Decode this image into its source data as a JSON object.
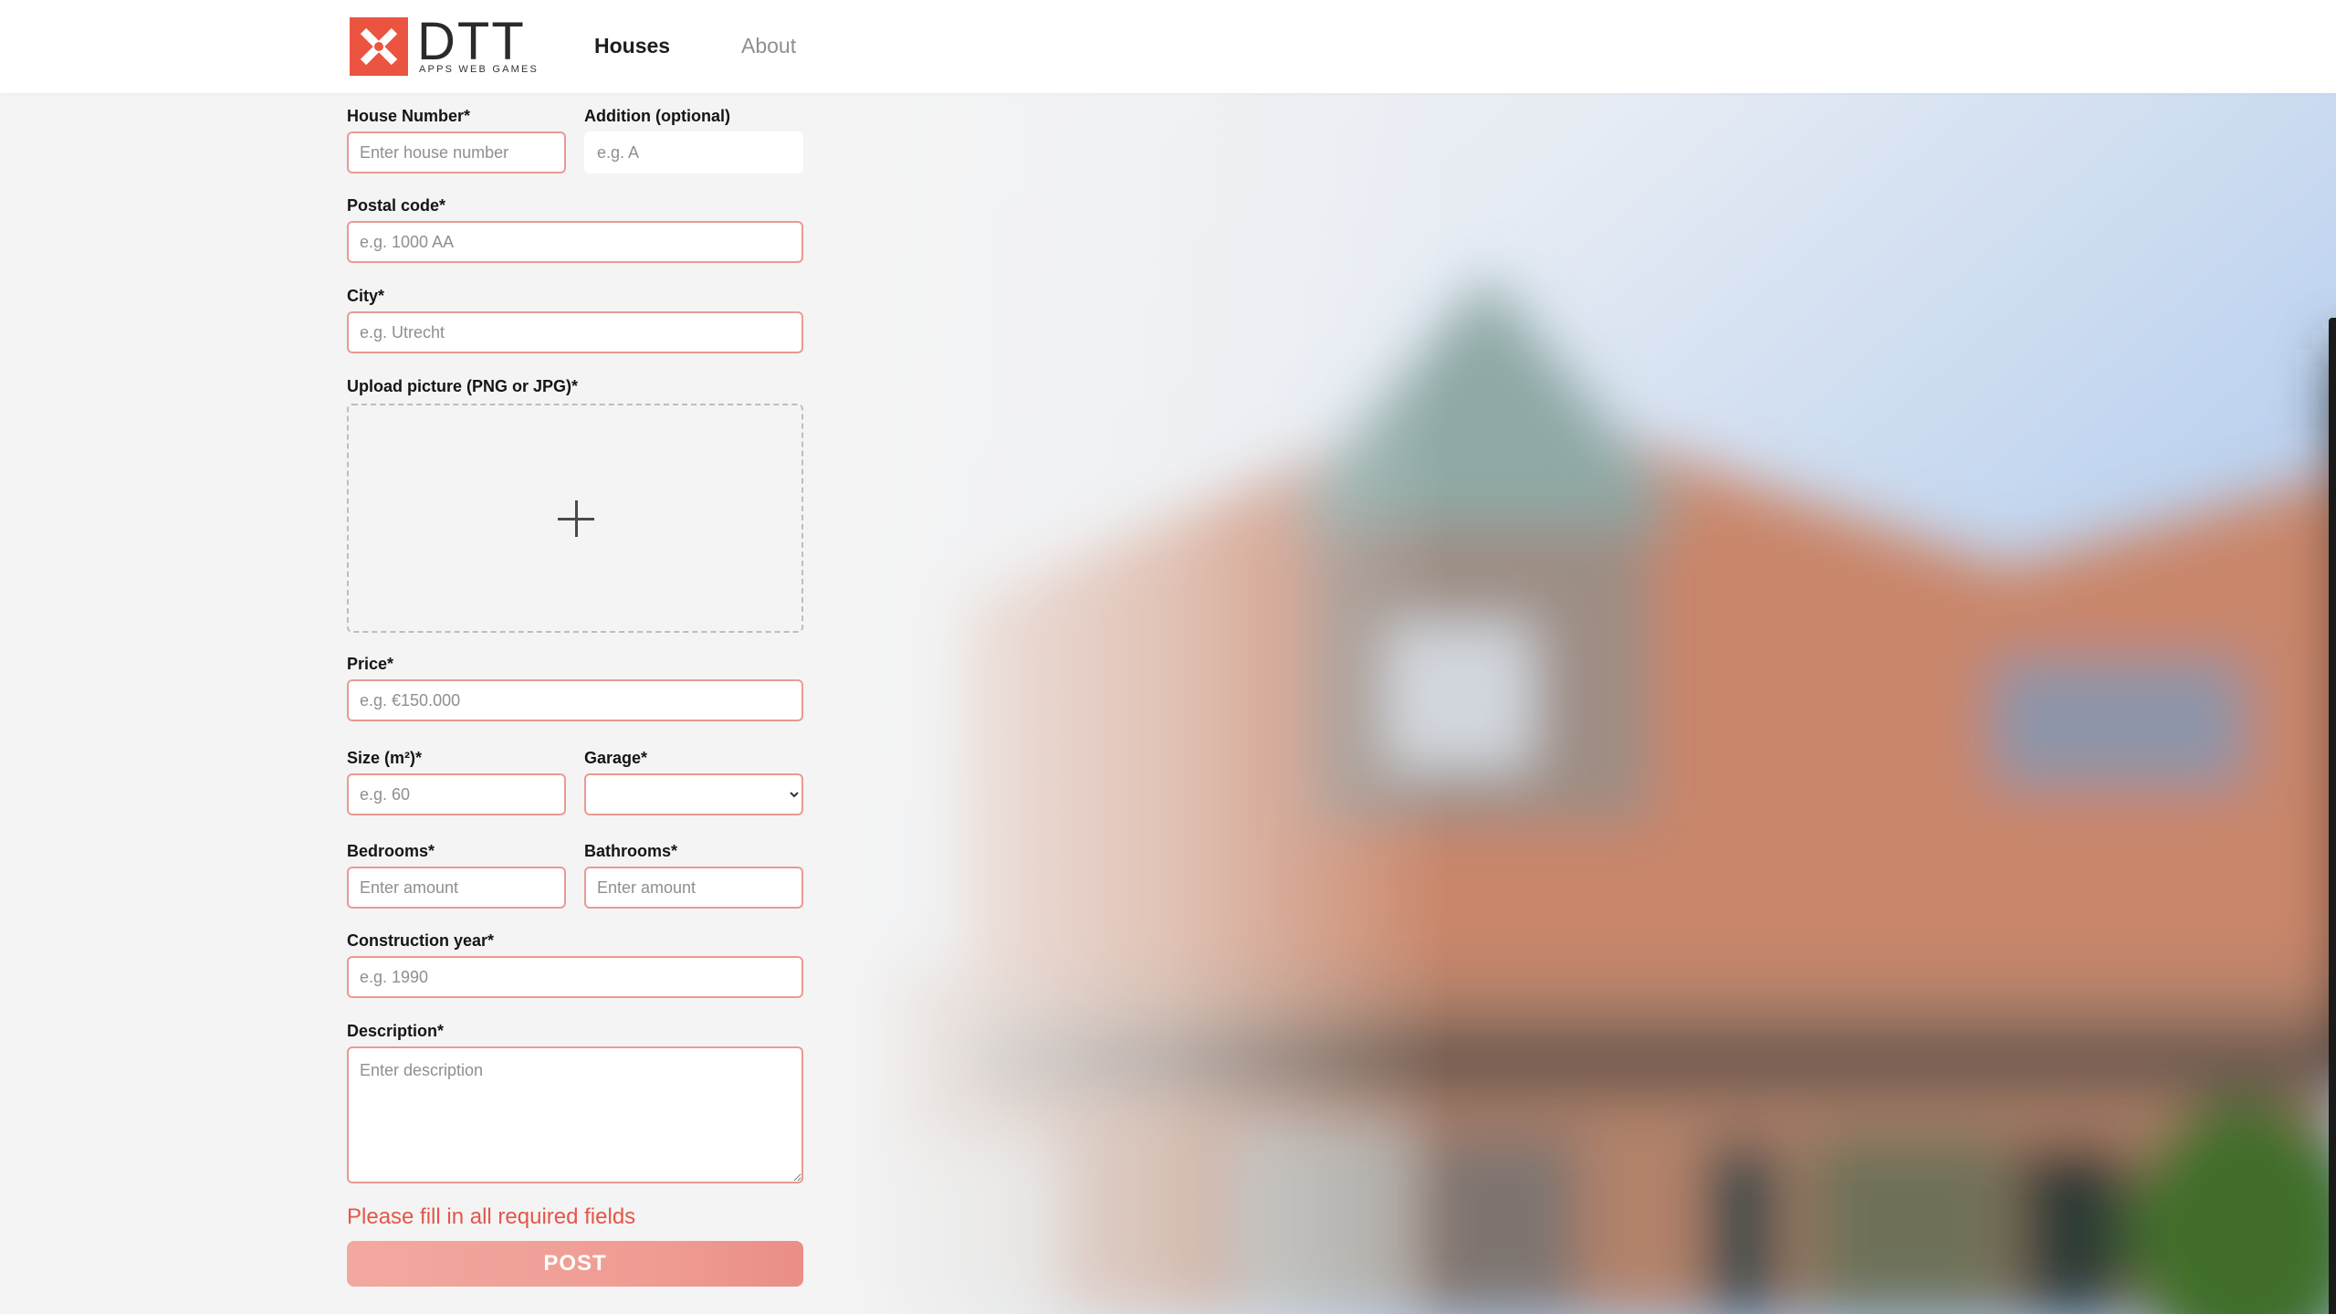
{
  "header": {
    "logo_text": "DTT",
    "logo_subtitle": "APPS WEB GAMES",
    "nav": [
      {
        "label": "Houses",
        "active": true
      },
      {
        "label": "About",
        "active": false
      }
    ]
  },
  "form": {
    "house_number": {
      "label": "House Number*",
      "placeholder": "Enter house number"
    },
    "addition": {
      "label": "Addition (optional)",
      "placeholder": "e.g. A"
    },
    "postal_code": {
      "label": "Postal code*",
      "placeholder": "e.g. 1000 AA"
    },
    "city": {
      "label": "City*",
      "placeholder": "e.g. Utrecht"
    },
    "upload": {
      "label": "Upload picture (PNG or JPG)*",
      "icon": "plus-icon"
    },
    "price": {
      "label": "Price*",
      "placeholder": "e.g. €150.000"
    },
    "size": {
      "label": "Size (m²)*",
      "placeholder": "e.g. 60"
    },
    "garage": {
      "label": "Garage*",
      "selected": ""
    },
    "bedrooms": {
      "label": "Bedrooms*",
      "placeholder": "Enter amount"
    },
    "bathrooms": {
      "label": "Bathrooms*",
      "placeholder": "Enter amount"
    },
    "construction_year": {
      "label": "Construction year*",
      "placeholder": "e.g. 1990"
    },
    "description": {
      "label": "Description*",
      "placeholder": "Enter description"
    },
    "error_message": "Please fill in all required fields",
    "post_label": "POST"
  },
  "colors": {
    "brand": "#eb5440",
    "error_border": "#ea9a92",
    "error_text": "#e4564a",
    "button": "#f2a8a0"
  }
}
